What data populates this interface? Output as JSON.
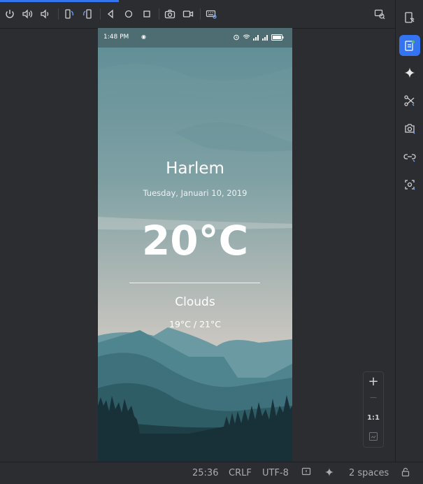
{
  "ide": {
    "status_bar": {
      "position": "25:36",
      "line_ending": "CRLF",
      "encoding": "UTF-8",
      "indent": "2 spaces"
    },
    "zoom_controls": {
      "zoom_in": "+",
      "zoom_out": "—",
      "actual_size": "1:1"
    }
  },
  "phone": {
    "status_time": "1:48 PM",
    "status_icons": [
      "alarm-icon",
      "wifi-icon",
      "signal-icon",
      "signal-icon",
      "battery-icon"
    ]
  },
  "weather": {
    "city": "Harlem",
    "date": "Tuesday, Januari 10, 2019",
    "temperature": "20°C",
    "condition": "Clouds",
    "range": "19°C / 21°C"
  },
  "colors": {
    "accent": "#3574f0",
    "ide_background": "#2b2d30",
    "sky_top": "#5e8c96",
    "sky_bottom": "#c9c6c0",
    "mountain_dark": "#183038"
  }
}
